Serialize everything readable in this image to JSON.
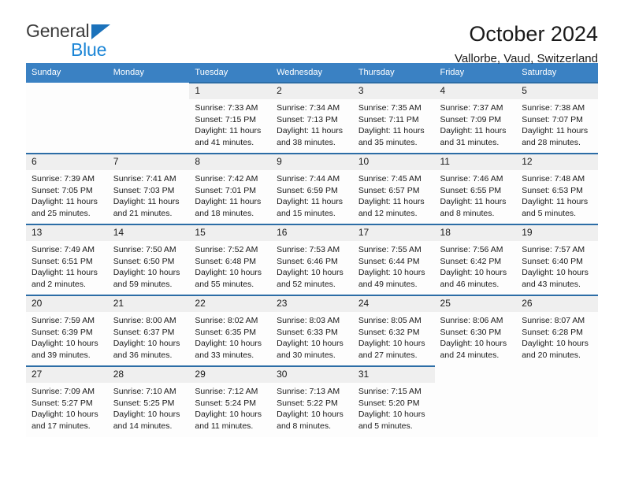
{
  "brand": {
    "name_top": "General",
    "name_bottom": "Blue",
    "accent_color": "#1b85d6",
    "triangle_color": "#1b72bb"
  },
  "header": {
    "title": "October 2024",
    "subtitle": "Vallorbe, Vaud, Switzerland"
  },
  "calendar": {
    "header_bg": "#3a81c3",
    "daynum_bg": "#efefef",
    "cell_top_border": "#2c6da6",
    "weekday_headers": [
      "Sunday",
      "Monday",
      "Tuesday",
      "Wednesday",
      "Thursday",
      "Friday",
      "Saturday"
    ],
    "weeks": [
      [
        {
          "day": ""
        },
        {
          "day": ""
        },
        {
          "day": "1",
          "sunrise": "Sunrise: 7:33 AM",
          "sunset": "Sunset: 7:15 PM",
          "daylight1": "Daylight: 11 hours",
          "daylight2": "and 41 minutes."
        },
        {
          "day": "2",
          "sunrise": "Sunrise: 7:34 AM",
          "sunset": "Sunset: 7:13 PM",
          "daylight1": "Daylight: 11 hours",
          "daylight2": "and 38 minutes."
        },
        {
          "day": "3",
          "sunrise": "Sunrise: 7:35 AM",
          "sunset": "Sunset: 7:11 PM",
          "daylight1": "Daylight: 11 hours",
          "daylight2": "and 35 minutes."
        },
        {
          "day": "4",
          "sunrise": "Sunrise: 7:37 AM",
          "sunset": "Sunset: 7:09 PM",
          "daylight1": "Daylight: 11 hours",
          "daylight2": "and 31 minutes."
        },
        {
          "day": "5",
          "sunrise": "Sunrise: 7:38 AM",
          "sunset": "Sunset: 7:07 PM",
          "daylight1": "Daylight: 11 hours",
          "daylight2": "and 28 minutes."
        }
      ],
      [
        {
          "day": "6",
          "sunrise": "Sunrise: 7:39 AM",
          "sunset": "Sunset: 7:05 PM",
          "daylight1": "Daylight: 11 hours",
          "daylight2": "and 25 minutes."
        },
        {
          "day": "7",
          "sunrise": "Sunrise: 7:41 AM",
          "sunset": "Sunset: 7:03 PM",
          "daylight1": "Daylight: 11 hours",
          "daylight2": "and 21 minutes."
        },
        {
          "day": "8",
          "sunrise": "Sunrise: 7:42 AM",
          "sunset": "Sunset: 7:01 PM",
          "daylight1": "Daylight: 11 hours",
          "daylight2": "and 18 minutes."
        },
        {
          "day": "9",
          "sunrise": "Sunrise: 7:44 AM",
          "sunset": "Sunset: 6:59 PM",
          "daylight1": "Daylight: 11 hours",
          "daylight2": "and 15 minutes."
        },
        {
          "day": "10",
          "sunrise": "Sunrise: 7:45 AM",
          "sunset": "Sunset: 6:57 PM",
          "daylight1": "Daylight: 11 hours",
          "daylight2": "and 12 minutes."
        },
        {
          "day": "11",
          "sunrise": "Sunrise: 7:46 AM",
          "sunset": "Sunset: 6:55 PM",
          "daylight1": "Daylight: 11 hours",
          "daylight2": "and 8 minutes."
        },
        {
          "day": "12",
          "sunrise": "Sunrise: 7:48 AM",
          "sunset": "Sunset: 6:53 PM",
          "daylight1": "Daylight: 11 hours",
          "daylight2": "and 5 minutes."
        }
      ],
      [
        {
          "day": "13",
          "sunrise": "Sunrise: 7:49 AM",
          "sunset": "Sunset: 6:51 PM",
          "daylight1": "Daylight: 11 hours",
          "daylight2": "and 2 minutes."
        },
        {
          "day": "14",
          "sunrise": "Sunrise: 7:50 AM",
          "sunset": "Sunset: 6:50 PM",
          "daylight1": "Daylight: 10 hours",
          "daylight2": "and 59 minutes."
        },
        {
          "day": "15",
          "sunrise": "Sunrise: 7:52 AM",
          "sunset": "Sunset: 6:48 PM",
          "daylight1": "Daylight: 10 hours",
          "daylight2": "and 55 minutes."
        },
        {
          "day": "16",
          "sunrise": "Sunrise: 7:53 AM",
          "sunset": "Sunset: 6:46 PM",
          "daylight1": "Daylight: 10 hours",
          "daylight2": "and 52 minutes."
        },
        {
          "day": "17",
          "sunrise": "Sunrise: 7:55 AM",
          "sunset": "Sunset: 6:44 PM",
          "daylight1": "Daylight: 10 hours",
          "daylight2": "and 49 minutes."
        },
        {
          "day": "18",
          "sunrise": "Sunrise: 7:56 AM",
          "sunset": "Sunset: 6:42 PM",
          "daylight1": "Daylight: 10 hours",
          "daylight2": "and 46 minutes."
        },
        {
          "day": "19",
          "sunrise": "Sunrise: 7:57 AM",
          "sunset": "Sunset: 6:40 PM",
          "daylight1": "Daylight: 10 hours",
          "daylight2": "and 43 minutes."
        }
      ],
      [
        {
          "day": "20",
          "sunrise": "Sunrise: 7:59 AM",
          "sunset": "Sunset: 6:39 PM",
          "daylight1": "Daylight: 10 hours",
          "daylight2": "and 39 minutes."
        },
        {
          "day": "21",
          "sunrise": "Sunrise: 8:00 AM",
          "sunset": "Sunset: 6:37 PM",
          "daylight1": "Daylight: 10 hours",
          "daylight2": "and 36 minutes."
        },
        {
          "day": "22",
          "sunrise": "Sunrise: 8:02 AM",
          "sunset": "Sunset: 6:35 PM",
          "daylight1": "Daylight: 10 hours",
          "daylight2": "and 33 minutes."
        },
        {
          "day": "23",
          "sunrise": "Sunrise: 8:03 AM",
          "sunset": "Sunset: 6:33 PM",
          "daylight1": "Daylight: 10 hours",
          "daylight2": "and 30 minutes."
        },
        {
          "day": "24",
          "sunrise": "Sunrise: 8:05 AM",
          "sunset": "Sunset: 6:32 PM",
          "daylight1": "Daylight: 10 hours",
          "daylight2": "and 27 minutes."
        },
        {
          "day": "25",
          "sunrise": "Sunrise: 8:06 AM",
          "sunset": "Sunset: 6:30 PM",
          "daylight1": "Daylight: 10 hours",
          "daylight2": "and 24 minutes."
        },
        {
          "day": "26",
          "sunrise": "Sunrise: 8:07 AM",
          "sunset": "Sunset: 6:28 PM",
          "daylight1": "Daylight: 10 hours",
          "daylight2": "and 20 minutes."
        }
      ],
      [
        {
          "day": "27",
          "sunrise": "Sunrise: 7:09 AM",
          "sunset": "Sunset: 5:27 PM",
          "daylight1": "Daylight: 10 hours",
          "daylight2": "and 17 minutes."
        },
        {
          "day": "28",
          "sunrise": "Sunrise: 7:10 AM",
          "sunset": "Sunset: 5:25 PM",
          "daylight1": "Daylight: 10 hours",
          "daylight2": "and 14 minutes."
        },
        {
          "day": "29",
          "sunrise": "Sunrise: 7:12 AM",
          "sunset": "Sunset: 5:24 PM",
          "daylight1": "Daylight: 10 hours",
          "daylight2": "and 11 minutes."
        },
        {
          "day": "30",
          "sunrise": "Sunrise: 7:13 AM",
          "sunset": "Sunset: 5:22 PM",
          "daylight1": "Daylight: 10 hours",
          "daylight2": "and 8 minutes."
        },
        {
          "day": "31",
          "sunrise": "Sunrise: 7:15 AM",
          "sunset": "Sunset: 5:20 PM",
          "daylight1": "Daylight: 10 hours",
          "daylight2": "and 5 minutes."
        },
        {
          "day": ""
        },
        {
          "day": ""
        }
      ]
    ]
  }
}
